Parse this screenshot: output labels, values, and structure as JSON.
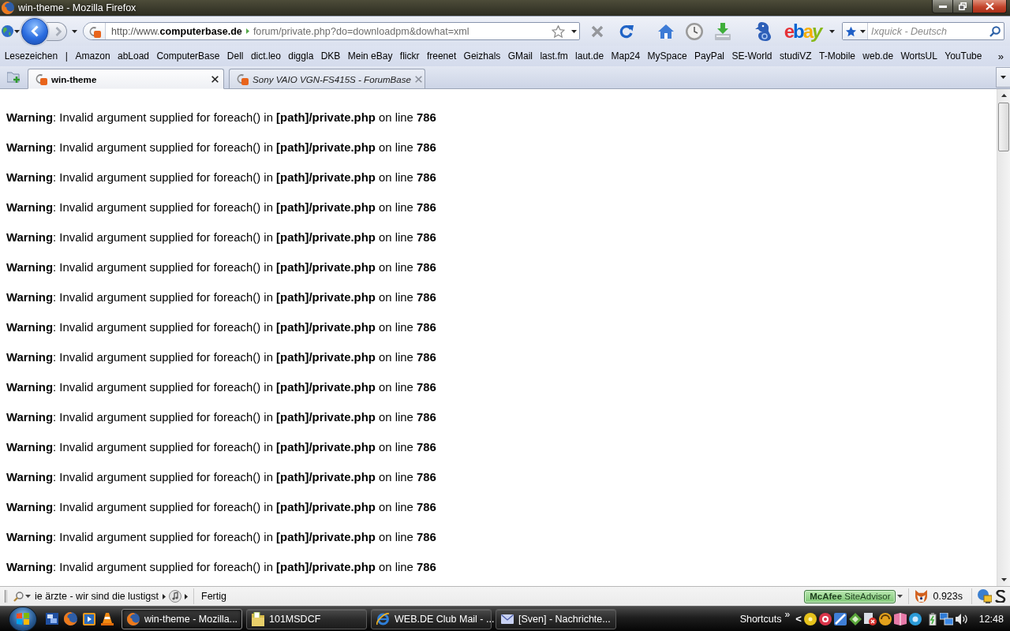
{
  "window": {
    "title": "win-theme - Mozilla Firefox"
  },
  "navigation": {
    "buttons": [
      {
        "kind": "back",
        "disabled": false
      },
      {
        "kind": "forward",
        "disabled": true
      }
    ],
    "url_host": "http://www.**computerbase.de**",
    "url_path": "forum/private.php?do=downloadpm&dowhat=xml"
  },
  "toolbar": [
    {
      "kind": "stop",
      "disabled": true
    },
    {
      "kind": "reload",
      "disabled": false
    },
    {
      "kind": "home",
      "disabled": false
    },
    {
      "kind": "history",
      "disabled": false
    },
    {
      "kind": "downloads",
      "disabled": false
    },
    {
      "kind": "seahorse",
      "disabled": false
    },
    {
      "kind": "logo",
      "disabled": false,
      "label": "ebay"
    }
  ],
  "search": {
    "placeholder": "Ixquick - Deutsch"
  },
  "bookmarks": {
    "title": "Lesezeichen",
    "separator": "|",
    "items": [
      "Amazon",
      "abLoad",
      "ComputerBase",
      "Dell",
      "dict.leo",
      "diggla",
      "DKB",
      "Mein eBay",
      "flickr",
      "freenet",
      "Geizhals",
      "GMail",
      "last.fm",
      "laut.de",
      "Map24",
      "MySpace",
      "PayPal",
      "SE-World",
      "studiVZ",
      "T-Mobile",
      "web.de",
      "WortsUL",
      "YouTube"
    ],
    "more": "»"
  },
  "tabs": [
    {
      "title": "win-theme",
      "selected": true
    },
    {
      "title": "Sony VAIO VGN-FS415S - ForumBase",
      "selected": false
    }
  ],
  "page": {
    "warnings": [
      "**Warning**: Invalid argument supplied for foreach() in **[path]/private.php** on line **786**",
      "**Warning**: Invalid argument supplied for foreach() in **[path]/private.php** on line **786**",
      "**Warning**: Invalid argument supplied for foreach() in **[path]/private.php** on line **786**",
      "**Warning**: Invalid argument supplied for foreach() in **[path]/private.php** on line **786**",
      "**Warning**: Invalid argument supplied for foreach() in **[path]/private.php** on line **786**",
      "**Warning**: Invalid argument supplied for foreach() in **[path]/private.php** on line **786**",
      "**Warning**: Invalid argument supplied for foreach() in **[path]/private.php** on line **786**",
      "**Warning**: Invalid argument supplied for foreach() in **[path]/private.php** on line **786**",
      "**Warning**: Invalid argument supplied for foreach() in **[path]/private.php** on line **786**",
      "**Warning**: Invalid argument supplied for foreach() in **[path]/private.php** on line **786**",
      "**Warning**: Invalid argument supplied for foreach() in **[path]/private.php** on line **786**",
      "**Warning**: Invalid argument supplied for foreach() in **[path]/private.php** on line **786**",
      "**Warning**: Invalid argument supplied for foreach() in **[path]/private.php** on line **786**",
      "**Warning**: Invalid argument supplied for foreach() in **[path]/private.php** on line **786**",
      "**Warning**: Invalid argument supplied for foreach() in **[path]/private.php** on line **786**",
      "**Warning**: Invalid argument supplied for foreach() in **[path]/private.php** on line **786**"
    ]
  },
  "status_bar": {
    "song": "ie ärzte - wir sind die lustigst",
    "status": "Fertig",
    "siteadvisor": "**McAfee** SiteAdvisor",
    "load_time": "0.923s"
  },
  "taskbar": {
    "tasks": [
      {
        "kind": "firefox",
        "label": "win-theme - Mozilla...",
        "selected": true
      },
      {
        "kind": "folder",
        "label": "101MSDCF",
        "selected": false
      },
      {
        "kind": "browser",
        "label": "WEB.DE Club Mail - ...",
        "selected": false
      },
      {
        "kind": "mail",
        "label": "[Sven] - Nachrichte...",
        "selected": false
      }
    ],
    "toolbar_label": "Shortcuts",
    "toolbar_more": "»",
    "tray_expand": "<",
    "clock": "12:48"
  }
}
